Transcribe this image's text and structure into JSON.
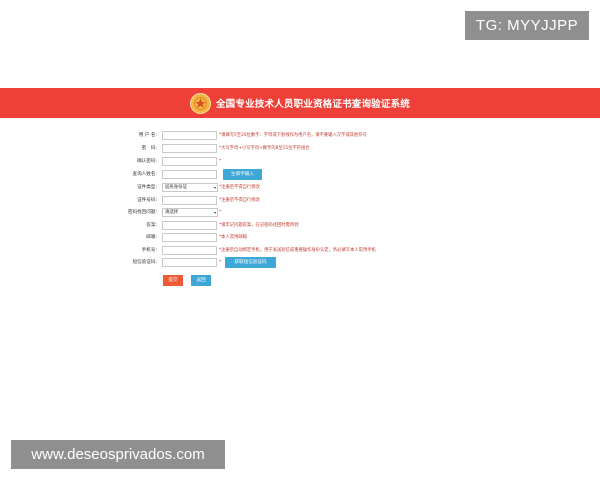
{
  "watermarks": {
    "top": "TG: MYYJJPP",
    "bottom": "www.deseosprivados.com"
  },
  "header": {
    "title": "全国专业技术人员职业资格证书查询验证系统",
    "bg_color": "#ee4038",
    "logo_icon": "emblem-icon"
  },
  "form": {
    "username": {
      "label": "用 户 名:",
      "value": "",
      "hint": "*请填写5至20位数字、字母或下划线作为用户名，请不要输入汉字或其他符号"
    },
    "password": {
      "label": "密　码:",
      "value": "",
      "hint": "*大写字母+小写字母+数字的8至15位字符组合"
    },
    "confirm_password": {
      "label": "确认密码:",
      "value": "",
      "hint": "*"
    },
    "real_name": {
      "label": "查询人姓名:",
      "value": "",
      "button": "生僻字输入"
    },
    "id_type": {
      "label": "证件类型:",
      "selected": "居民身份证",
      "hint": "*注册后不得自行修改"
    },
    "id_number": {
      "label": "证件号码:",
      "value": "",
      "hint": "*注册后不得自行修改"
    },
    "security_question": {
      "label": "密码找回问题:",
      "selected": "请选择",
      "hint": "*"
    },
    "answer": {
      "label": "答案:",
      "value": "",
      "hint": "*请牢记问题答案，在记密码找回时需用到"
    },
    "email": {
      "label": "邮箱:",
      "value": "",
      "hint": "*本人常用邮箱"
    },
    "mobile": {
      "label": "手机号:",
      "value": "",
      "hint": "*注册后自动绑定手机，用于发送短信或重要操作身份认定，务必填写本人常用手机"
    },
    "sms_code": {
      "label": "短信验证码:",
      "value": "",
      "hint": "*",
      "button": "获取短信验证码"
    },
    "submit_label": "提交",
    "return_label": "返回"
  }
}
